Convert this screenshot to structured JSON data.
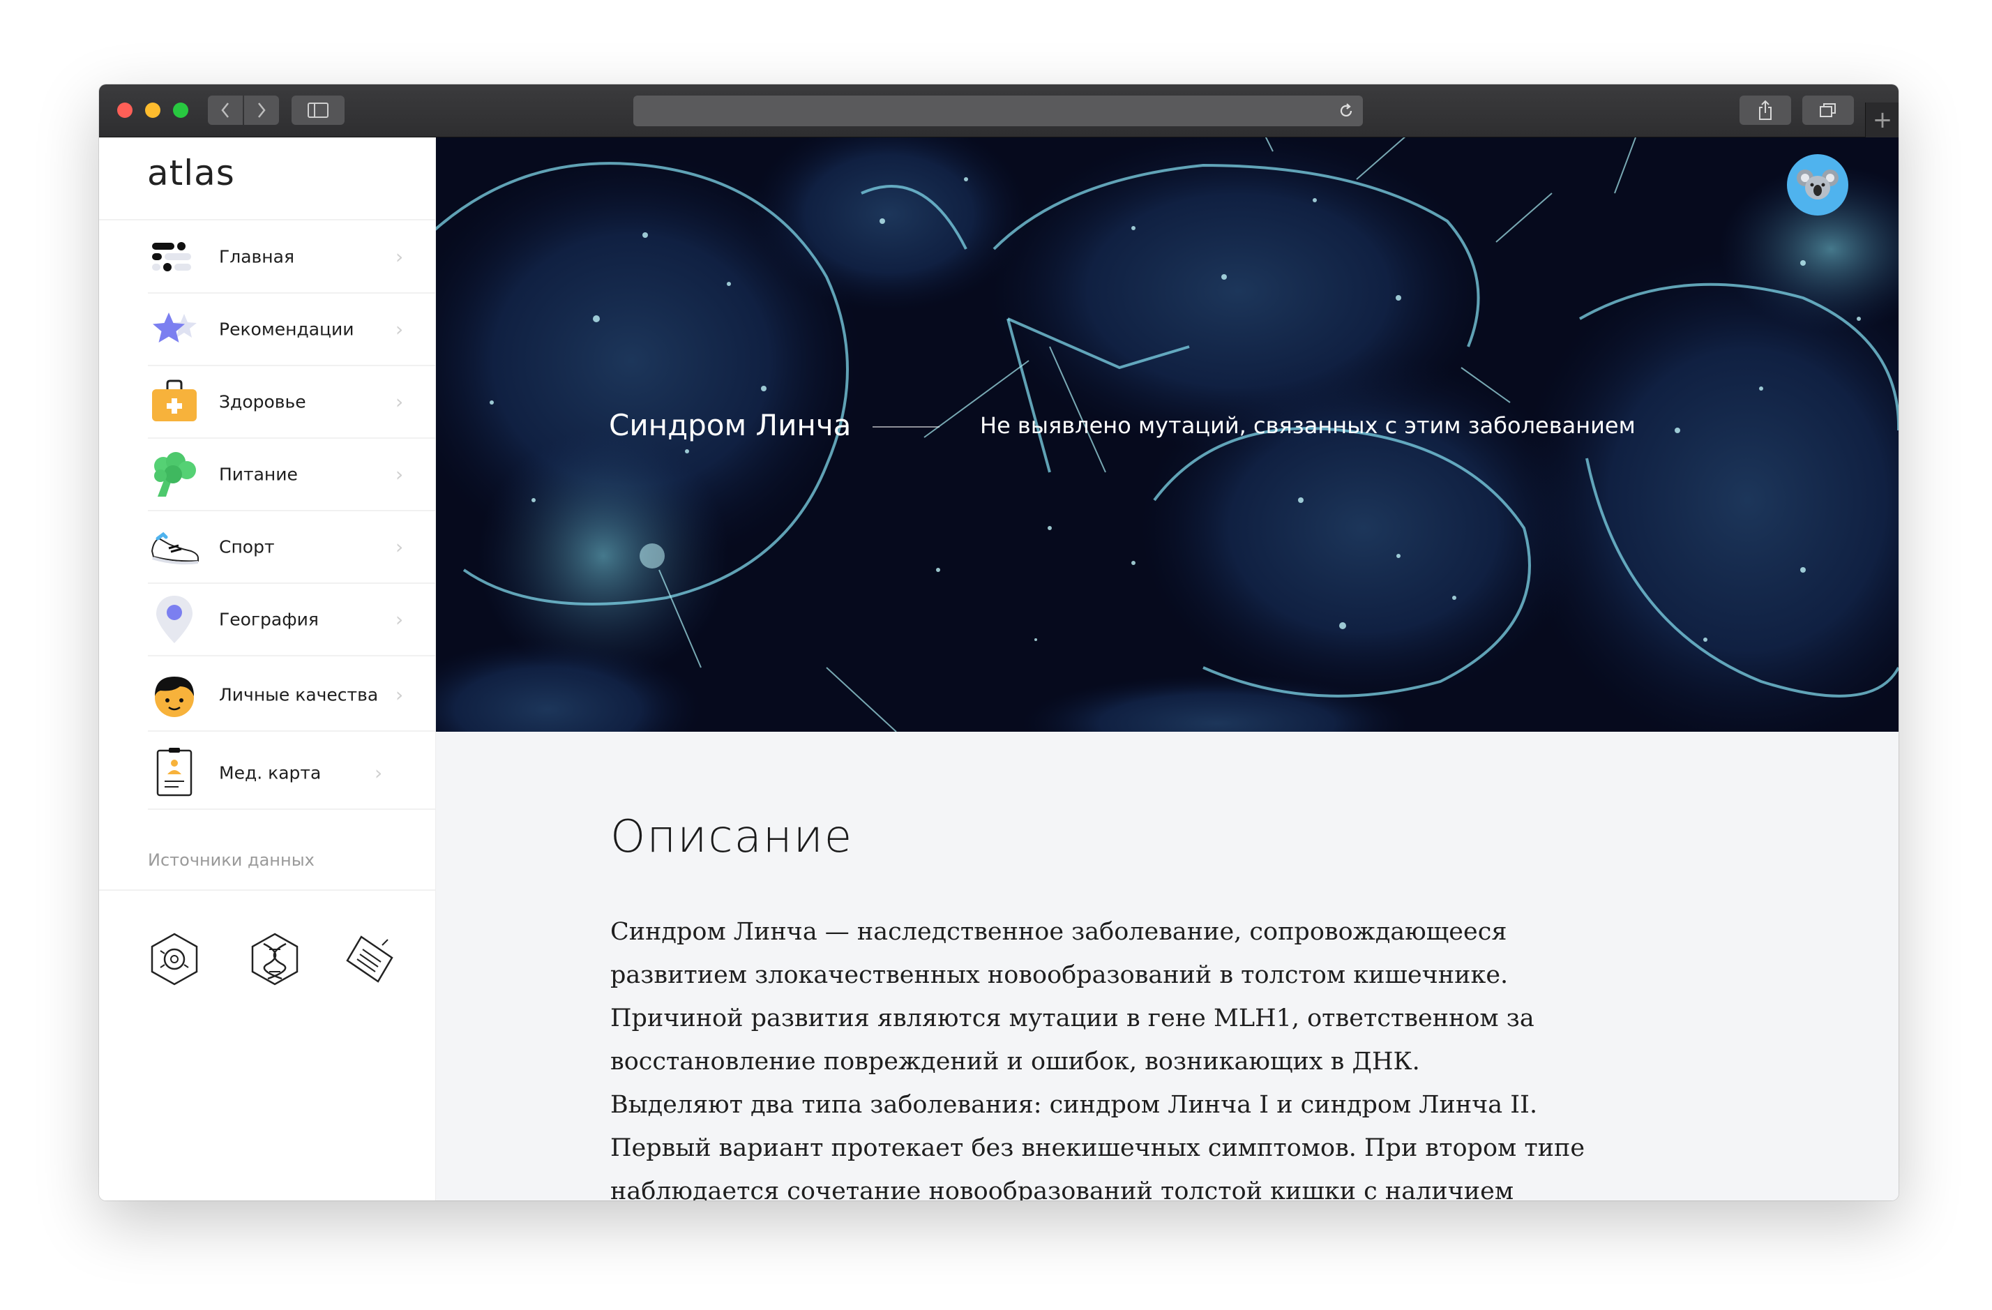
{
  "browser": {
    "url": "",
    "new_tab_symbol": "+"
  },
  "app": {
    "logo": "atlas"
  },
  "sidebar": {
    "items": [
      {
        "label": "Главная",
        "icon": "home-blocks-icon"
      },
      {
        "label": "Рекомендации",
        "icon": "star-icon"
      },
      {
        "label": "Здоровье",
        "icon": "medkit-icon"
      },
      {
        "label": "Питание",
        "icon": "broccoli-icon"
      },
      {
        "label": "Спорт",
        "icon": "sneaker-icon"
      },
      {
        "label": "География",
        "icon": "map-pin-icon"
      },
      {
        "label": "Личные качества",
        "icon": "face-icon"
      },
      {
        "label": "Мед. карта",
        "icon": "medical-card-icon"
      }
    ],
    "chevron": "›",
    "sources_label": "Источники данных",
    "sources": [
      {
        "icon": "camera-hexagon-icon"
      },
      {
        "icon": "dna-hexagon-icon"
      },
      {
        "icon": "document-tag-icon"
      }
    ]
  },
  "hero": {
    "title": "Синдром Линча",
    "subtitle": "Не выявлено мутаций, связанных с этим заболеванием",
    "avatar_icon": "koala-avatar-icon"
  },
  "content": {
    "section_title": "Описание",
    "paragraphs": [
      "Синдром Линча — наследственное заболевание, сопровождающееся развитием злокачественных новообразований в толстом кишечнике. Причиной развития являются мутации в гене MLH1, ответственном за восстановление повреждений и ошибок, возникающих в ДНК.",
      "Выделяют два типа заболевания: синдром Линча I и синдром Линча II. Первый вариант протекает без внекишечных симптомов. При втором типе наблюдается сочетание новообразований толстой кишки с наличием злокачественных опухолей"
    ]
  },
  "colors": {
    "accent_blue": "#4fb3ee",
    "hero_bg": "#060a1d",
    "cell_glow": "#7fd6e8",
    "content_bg": "#f4f5f7"
  }
}
